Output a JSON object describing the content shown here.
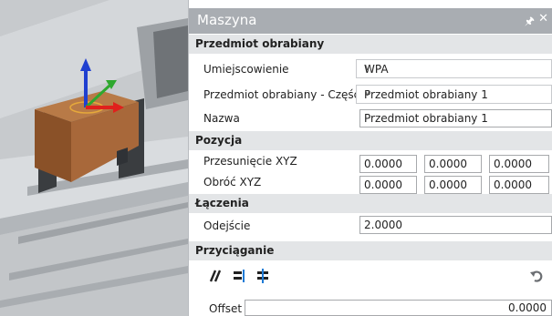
{
  "panel": {
    "title": "Maszyna",
    "pin_glyph": "↕",
    "close_glyph": "✕"
  },
  "sections": {
    "workpiece": "Przedmiot obrabiany",
    "position": "Pozycja",
    "connections": "Łączenia",
    "snapping": "Przyciąganie"
  },
  "fields": {
    "placement_label": "Umiejscowienie",
    "placement_value": "WPA",
    "workpiece_part_label": "Przedmiot obrabiany - Część",
    "workpiece_part_value": "Przedmiot obrabiany 1",
    "name_label": "Nazwa",
    "name_value": "Przedmiot obrabiany 1",
    "offset_xyz_label": "Przesunięcie XYZ",
    "offset_xyz": [
      "0.0000",
      "0.0000",
      "0.0000"
    ],
    "rotate_xyz_label": "Obróć XYZ",
    "rotate_xyz": [
      "0.0000",
      "0.0000",
      "0.0000"
    ],
    "distance_label": "Odejście",
    "distance_value": "2.0000",
    "offset_label": "Offset",
    "offset_value": "0.0000"
  },
  "icons": {
    "chevron": "chevron-down-icon",
    "snap_tools": [
      "parallel-snap-icon",
      "align-edge-icon",
      "center-snap-icon"
    ],
    "undo": "undo-icon"
  },
  "colors": {
    "titlebar": "#a9adb2",
    "section": "#e3e5e7",
    "workpiece": "#a8683a",
    "axis_x": "#e0201c",
    "axis_y": "#2ea82e",
    "axis_z": "#1f3fd0"
  }
}
